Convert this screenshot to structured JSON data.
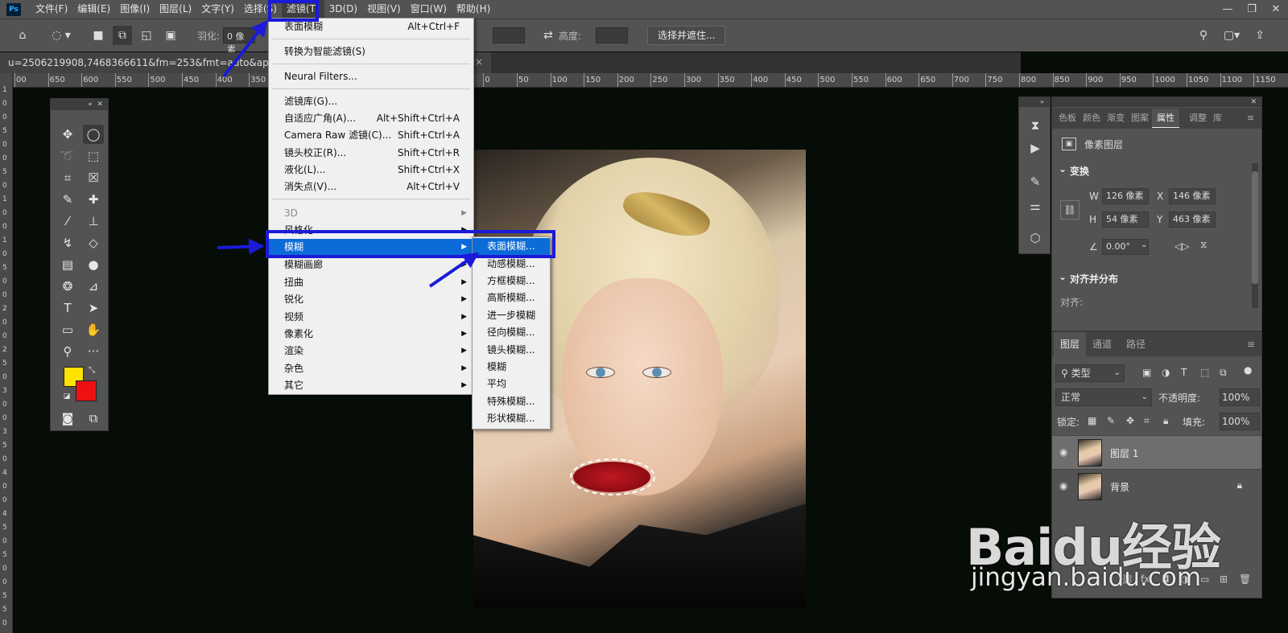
{
  "app": {
    "logo": "Ps"
  },
  "menubar": {
    "items": [
      "文件(F)",
      "编辑(E)",
      "图像(I)",
      "图层(L)",
      "文字(Y)",
      "选择(S)",
      "滤镜(T)",
      "3D(D)",
      "视图(V)",
      "窗口(W)",
      "帮助(H)"
    ],
    "active": "滤镜(T)"
  },
  "window_controls": {
    "minimize": "—",
    "restore": "❐",
    "close": "✕"
  },
  "options_bar": {
    "feather_label": "羽化:",
    "feather_value": "0 像素",
    "height_label": "高度:",
    "select_mask_button": "选择并遮住..."
  },
  "document": {
    "tab_title": "u=2506219908,7468366611&fm=253&fmt=auto&app=138",
    "close": "×"
  },
  "ruler": {
    "h_labels": [
      "00",
      "650",
      "600",
      "550",
      "500",
      "450",
      "400",
      "350",
      "300",
      "250",
      "200",
      "150",
      "100",
      "50",
      "0",
      "50",
      "100",
      "150",
      "200",
      "250",
      "300",
      "350",
      "400",
      "450",
      "500",
      "550",
      "600",
      "650",
      "700",
      "750",
      "800",
      "850",
      "900",
      "950",
      "1000",
      "1050",
      "1100",
      "1150"
    ],
    "v_labels": [
      "1",
      "0",
      "0",
      "5",
      "0",
      "0",
      "5",
      "0",
      "1",
      "0",
      "0",
      "1",
      "0",
      "5",
      "0",
      "0",
      "2",
      "0",
      "0",
      "2",
      "5",
      "0",
      "3",
      "0",
      "0",
      "3",
      "5",
      "0",
      "4",
      "0",
      "0",
      "4",
      "5",
      "0",
      "5",
      "0",
      "0",
      "5",
      "5",
      "0"
    ]
  },
  "filter_menu": {
    "last_filter": "表面模糊",
    "last_filter_shortcut": "Alt+Ctrl+F",
    "smart_filter": "转换为智能滤镜(S)",
    "neural": "Neural Filters...",
    "gallery": {
      "label": "滤镜库(G)...",
      "shortcut": ""
    },
    "adaptive": {
      "label": "自适应广角(A)...",
      "shortcut": "Alt+Shift+Ctrl+A"
    },
    "camera_raw": {
      "label": "Camera Raw 滤镜(C)...",
      "shortcut": "Shift+Ctrl+A"
    },
    "lens": {
      "label": "镜头校正(R)...",
      "shortcut": "Shift+Ctrl+R"
    },
    "liquify": {
      "label": "液化(L)...",
      "shortcut": "Shift+Ctrl+X"
    },
    "vanishing": {
      "label": "消失点(V)...",
      "shortcut": "Alt+Ctrl+V"
    },
    "submenus": [
      "3D",
      "风格化",
      "模糊",
      "模糊画廊",
      "扭曲",
      "锐化",
      "视频",
      "像素化",
      "渲染",
      "杂色",
      "其它"
    ],
    "highlighted": "模糊"
  },
  "blur_submenu": {
    "items": [
      "表面模糊...",
      "动感模糊...",
      "方框模糊...",
      "高斯模糊...",
      "进一步模糊",
      "径向模糊...",
      "镜头模糊...",
      "模糊",
      "平均",
      "特殊模糊...",
      "形状模糊..."
    ],
    "highlighted": "表面模糊..."
  },
  "properties_panel": {
    "tabs": [
      "色板",
      "颜色",
      "渐变",
      "图案",
      "属性",
      "调整",
      "库"
    ],
    "active_tab": "属性",
    "layer_type": "像素图层",
    "transform_title": "变换",
    "w_label": "W",
    "w_value": "126 像素",
    "h_label": "H",
    "h_value": "54 像素",
    "x_label": "X",
    "x_value": "146 像素",
    "y_label": "Y",
    "y_value": "463 像素",
    "angle_value": "0.00°",
    "align_title": "对齐并分布",
    "align_label": "对齐:"
  },
  "layers_panel": {
    "tabs": [
      "图层",
      "通道",
      "路径"
    ],
    "active_tab": "图层",
    "filter_kind": "类型",
    "blend_mode": "正常",
    "opacity_label": "不透明度:",
    "opacity_value": "100%",
    "lock_label": "锁定:",
    "fill_label": "填充:",
    "fill_value": "100%",
    "layers": [
      {
        "name": "图层 1",
        "selected": true,
        "locked": false
      },
      {
        "name": "背景",
        "selected": false,
        "locked": true
      }
    ]
  },
  "watermark": {
    "logo": "Baidu经验",
    "url": "jingyan.baidu.com"
  },
  "colors": {
    "foreground": "#ffe400",
    "background": "#ee1111",
    "highlight": "#0a6bd9",
    "annotation": "#1a1ad8"
  }
}
